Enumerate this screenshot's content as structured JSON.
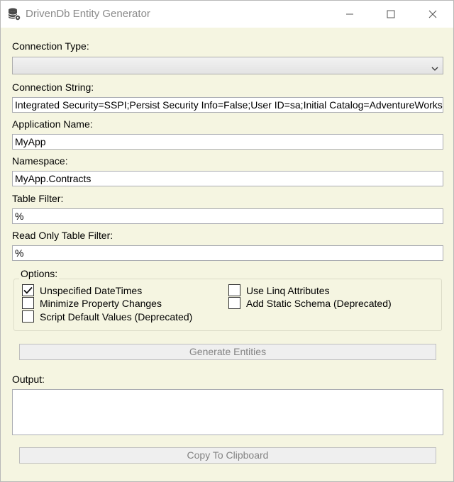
{
  "window": {
    "title": "DrivenDb Entity Generator",
    "app_icon": "database-gear-icon",
    "controls": [
      "minimize-icon",
      "maximize-icon",
      "close-icon"
    ]
  },
  "form": {
    "connection_type_label": "Connection Type:",
    "connection_type_value": "",
    "connection_string_label": "Connection String:",
    "connection_string_value": "Integrated Security=SSPI;Persist Security Info=False;User ID=sa;Initial Catalog=AdventureWorks",
    "application_name_label": "Application Name:",
    "application_name_value": "MyApp",
    "namespace_label": "Namespace:",
    "namespace_value": "MyApp.Contracts",
    "table_filter_label": "Table Filter:",
    "table_filter_value": "%",
    "readonly_filter_label": "Read Only Table Filter:",
    "readonly_filter_value": "%"
  },
  "options": {
    "label": "Options:",
    "items": [
      {
        "label": "Unspecified DateTimes",
        "checked": true
      },
      {
        "label": "Minimize Property Changes",
        "checked": false
      },
      {
        "label": "Script Default Values (Deprecated)",
        "checked": false
      },
      {
        "label": "Use Linq Attributes",
        "checked": false
      },
      {
        "label": "Add Static Schema (Deprecated)",
        "checked": false
      }
    ]
  },
  "actions": {
    "generate_label": "Generate Entities",
    "output_label": "Output:",
    "output_value": "",
    "copy_label": "Copy To Clipboard"
  },
  "colors": {
    "window_background": "#f5f5e1",
    "disabled_text": "#838383"
  }
}
